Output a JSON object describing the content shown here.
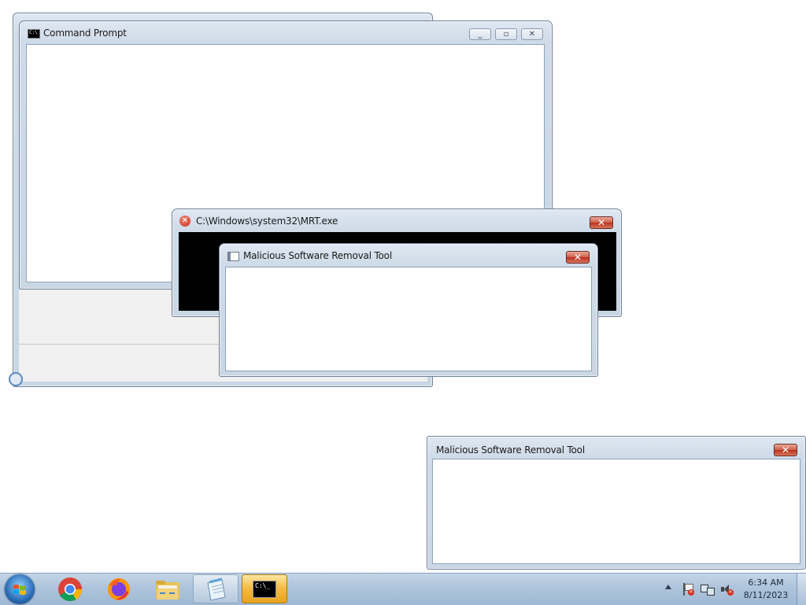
{
  "windows": {
    "cmd_main": {
      "title": "Command Prompt",
      "icon": "cmd-icon",
      "buttons": [
        "minimize",
        "restore",
        "close"
      ]
    },
    "mrt_console": {
      "title": "C:\\Windows\\system32\\MRT.exe",
      "icon": "error-icon"
    },
    "mrt_dialog_1": {
      "title": "Malicious Software Removal Tool",
      "icon": "app-window-icon"
    },
    "mrt_dialog_2": {
      "title": "Malicious Software Removal Tool"
    }
  },
  "taskbar": {
    "items": [
      {
        "name": "start-button",
        "icon": "windows-logo-icon"
      },
      {
        "name": "chrome",
        "icon": "chrome-icon"
      },
      {
        "name": "firefox",
        "icon": "firefox-icon"
      },
      {
        "name": "file-explorer",
        "icon": "folder-icon"
      },
      {
        "name": "notepad",
        "icon": "notepad-icon"
      },
      {
        "name": "command-prompt",
        "icon": "cmd-icon"
      }
    ],
    "clock": {
      "time": "6:34 AM",
      "date": "8/11/2023"
    },
    "tray_icons": [
      "show-hidden-icons-arrow-icon",
      "action-center-flag-icon",
      "network-icon",
      "volume-muted-icon"
    ]
  },
  "colors": {
    "taskbar": "#aec4dc",
    "close_button": "#c8452f",
    "active_taskbar_item": "#f5b93f"
  }
}
